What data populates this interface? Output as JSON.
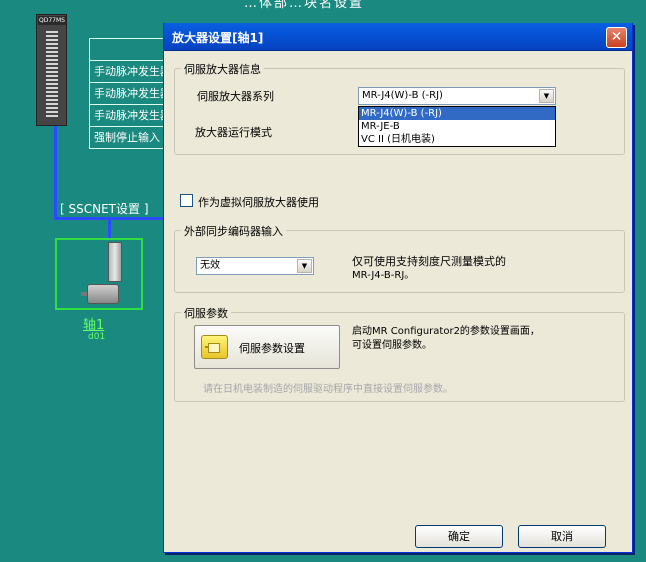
{
  "background": {
    "header_text": "…体部…块名设置",
    "module_label": "QD77MS",
    "signal_labels": [
      "",
      "手动脉冲发生器",
      "手动脉冲发生器",
      "手动脉冲发生器",
      "强制停止输入"
    ],
    "sscnet_label": "[ SSCNET设置 ]",
    "axis_name": "轴1",
    "axis_sub": "d01",
    "colors": {
      "canvas": "#1a8a80",
      "net_line": "#2a4bff",
      "axis_frame": "#33dd44"
    }
  },
  "dialog": {
    "title": "放大器设置[轴1]",
    "close_icon": "close-x-icon",
    "servo_info": {
      "legend": "伺服放大器信息",
      "series_label": "伺服放大器系列",
      "series_value": "MR-J4(W)-B (-RJ)",
      "series_options": [
        "MR-J4(W)-B (-RJ)",
        "MR-JE-B",
        "VC II (日机电装)"
      ],
      "mode_label": "放大器运行模式"
    },
    "virtual_checkbox_label": "作为虚拟伺服放大器使用",
    "encoder": {
      "legend": "外部同步编码器输入",
      "value": "无效",
      "note_line1": "仅可使用支持刻度尺测量模式的",
      "note_line2": "MR-J4-B-RJ。"
    },
    "servo_param": {
      "legend": "伺服参数",
      "button_label": "伺服参数设置",
      "desc_line1": "启动MR Configurator2的参数设置画面，",
      "desc_line2": "可设置伺服参数。",
      "disabled_note": "请在日机电装制造的伺服驱动程序中直接设置伺服参数。"
    },
    "ok_label": "确定",
    "cancel_label": "取消"
  }
}
